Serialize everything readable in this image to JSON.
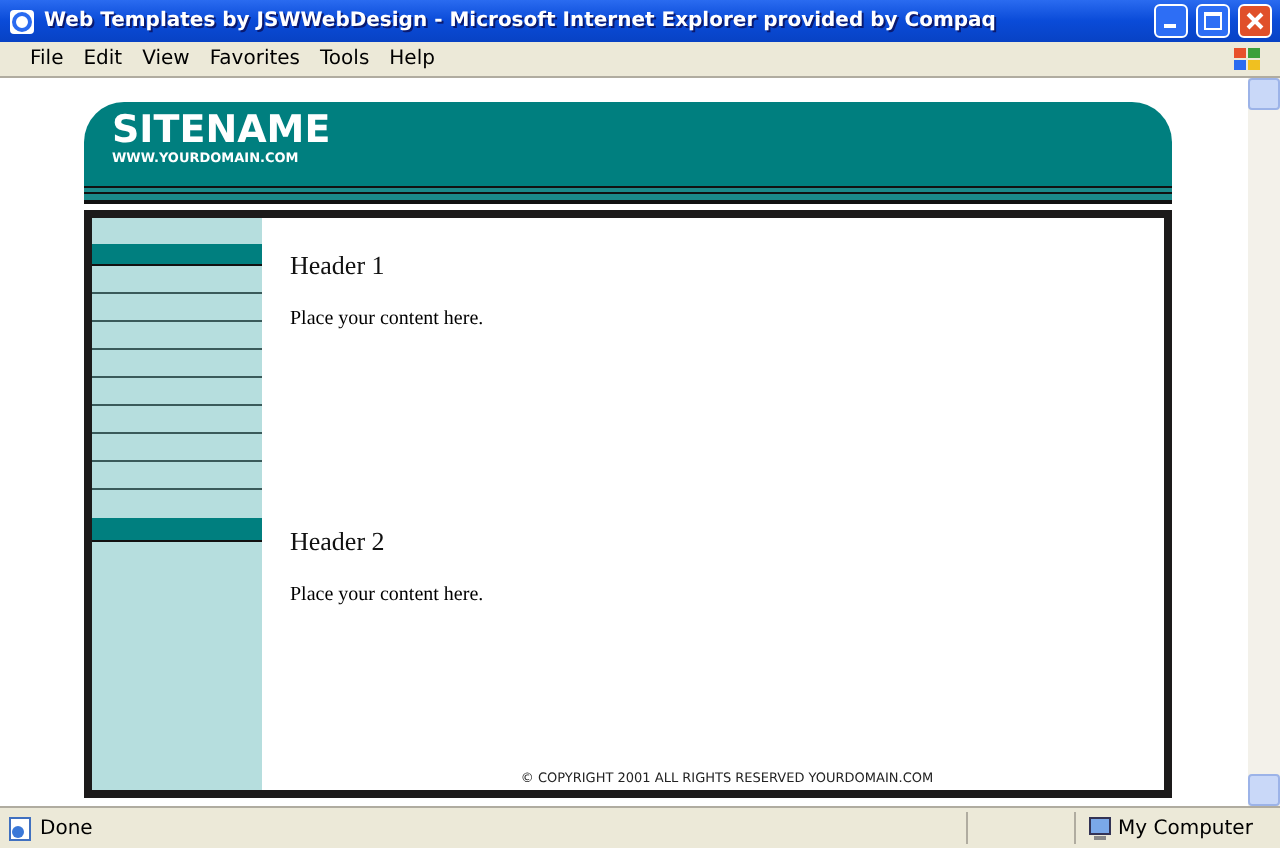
{
  "window": {
    "title": "Web Templates by JSWWebDesign - Microsoft Internet Explorer provided by Compaq"
  },
  "menu": [
    "File",
    "Edit",
    "View",
    "Favorites",
    "Tools",
    "Help"
  ],
  "site": {
    "name": "SITENAME",
    "domain": "WWW.YOURDOMAIN.COM",
    "sections": [
      {
        "header": "Header 1",
        "text": "Place your content here."
      },
      {
        "header": "Header 2",
        "text": "Place your content here."
      }
    ],
    "copyright": "© COPYRIGHT 2001 ALL RIGHTS RESERVED YOURDOMAIN.COM"
  },
  "status_bar": {
    "text": "Done",
    "zone": "My Computer"
  }
}
